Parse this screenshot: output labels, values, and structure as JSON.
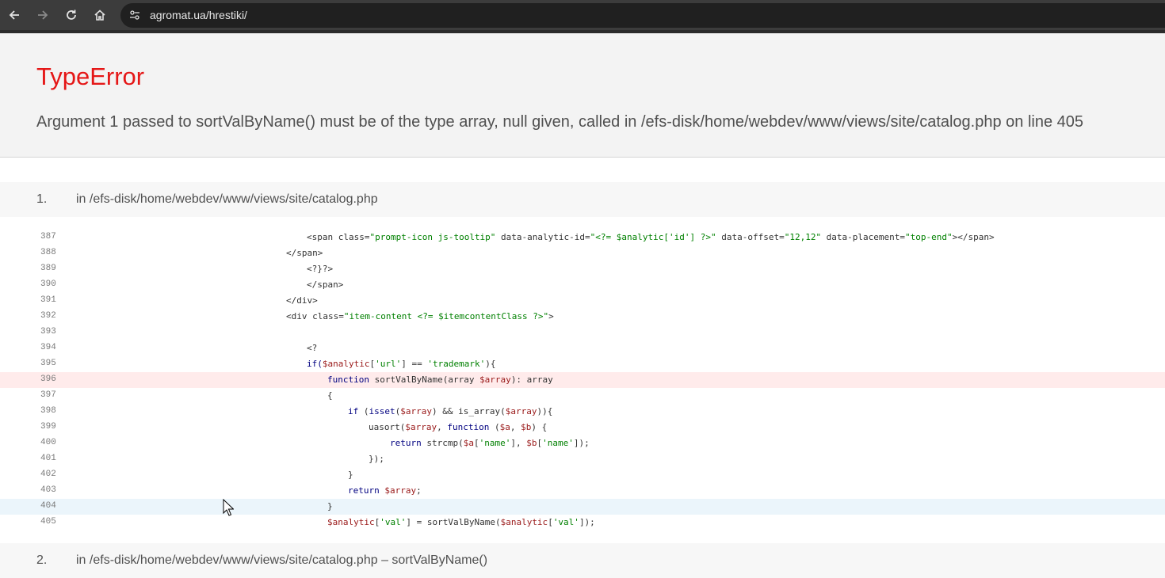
{
  "browser": {
    "url": "agromat.ua/hrestiki/",
    "icons": [
      "back-arrow-icon",
      "forward-arrow-icon",
      "reload-icon",
      "home-icon",
      "site-info-icon"
    ]
  },
  "error": {
    "title": "TypeError",
    "message": "Argument 1 passed to sortValByName() must be of the type array, null given, called in /efs-disk/home/webdev/www/views/site/catalog.php on line 405"
  },
  "frames": [
    {
      "number": "1.",
      "location": "in /efs-disk/home/webdev/www/views/site/catalog.php"
    },
    {
      "number": "2.",
      "location": "in /efs-disk/home/webdev/www/views/site/catalog.php – sortValByName()"
    }
  ],
  "code_lines": [
    {
      "num": "387"
    },
    {
      "num": "388"
    },
    {
      "num": "389"
    },
    {
      "num": "390"
    },
    {
      "num": "391"
    },
    {
      "num": "392"
    },
    {
      "num": "393"
    },
    {
      "num": "394"
    },
    {
      "num": "395"
    },
    {
      "num": "396"
    },
    {
      "num": "397"
    },
    {
      "num": "398"
    },
    {
      "num": "399"
    },
    {
      "num": "400"
    },
    {
      "num": "401"
    },
    {
      "num": "402"
    },
    {
      "num": "403"
    },
    {
      "num": "404"
    },
    {
      "num": "405"
    }
  ],
  "code": {
    "l387": [
      "<span class=",
      "\"prompt-icon js-tooltip\"",
      " data-analytic-id=",
      "\"<?= $analytic['id'] ?>\"",
      " data-offset=",
      "\"12,12\"",
      " data-placement=",
      "\"top-end\"",
      "></span>"
    ],
    "l388": "</span>",
    "l389": "<?}?>",
    "l390": "</span>",
    "l391": "</div>",
    "l392": [
      "<div class=",
      "\"item-content <?= $itemcontentClass ?>\"",
      ">"
    ],
    "l394": "<?",
    "l395": [
      "if(",
      "$analytic",
      "[",
      "'url'",
      "] == ",
      "'trademark'",
      "){"
    ],
    "l396": [
      "function",
      " sortValByName(array ",
      "$array",
      "): array"
    ],
    "l397": "{",
    "l398": [
      "if",
      " (",
      "isset",
      "(",
      "$array",
      ") && is_array(",
      "$array",
      ")){"
    ],
    "l399": [
      "uasort(",
      "$array",
      ", ",
      "function",
      " (",
      "$a",
      ", ",
      "$b",
      ") {"
    ],
    "l400": [
      "return",
      " strcmp(",
      "$a",
      "[",
      "'name'",
      "], ",
      "$b",
      "[",
      "'name'",
      "]);"
    ],
    "l401": "});",
    "l402": "}",
    "l403": [
      "return",
      " ",
      "$array",
      ";"
    ],
    "l404": "}",
    "l405": [
      "$analytic",
      "[",
      "'val'",
      "] = sortValByName(",
      "$analytic",
      "[",
      "'val'",
      "]);"
    ]
  },
  "colors": {
    "error_title": "#e51717",
    "error_line_bg": "#ffebeb",
    "current_line_bg": "#ebf5fb"
  }
}
